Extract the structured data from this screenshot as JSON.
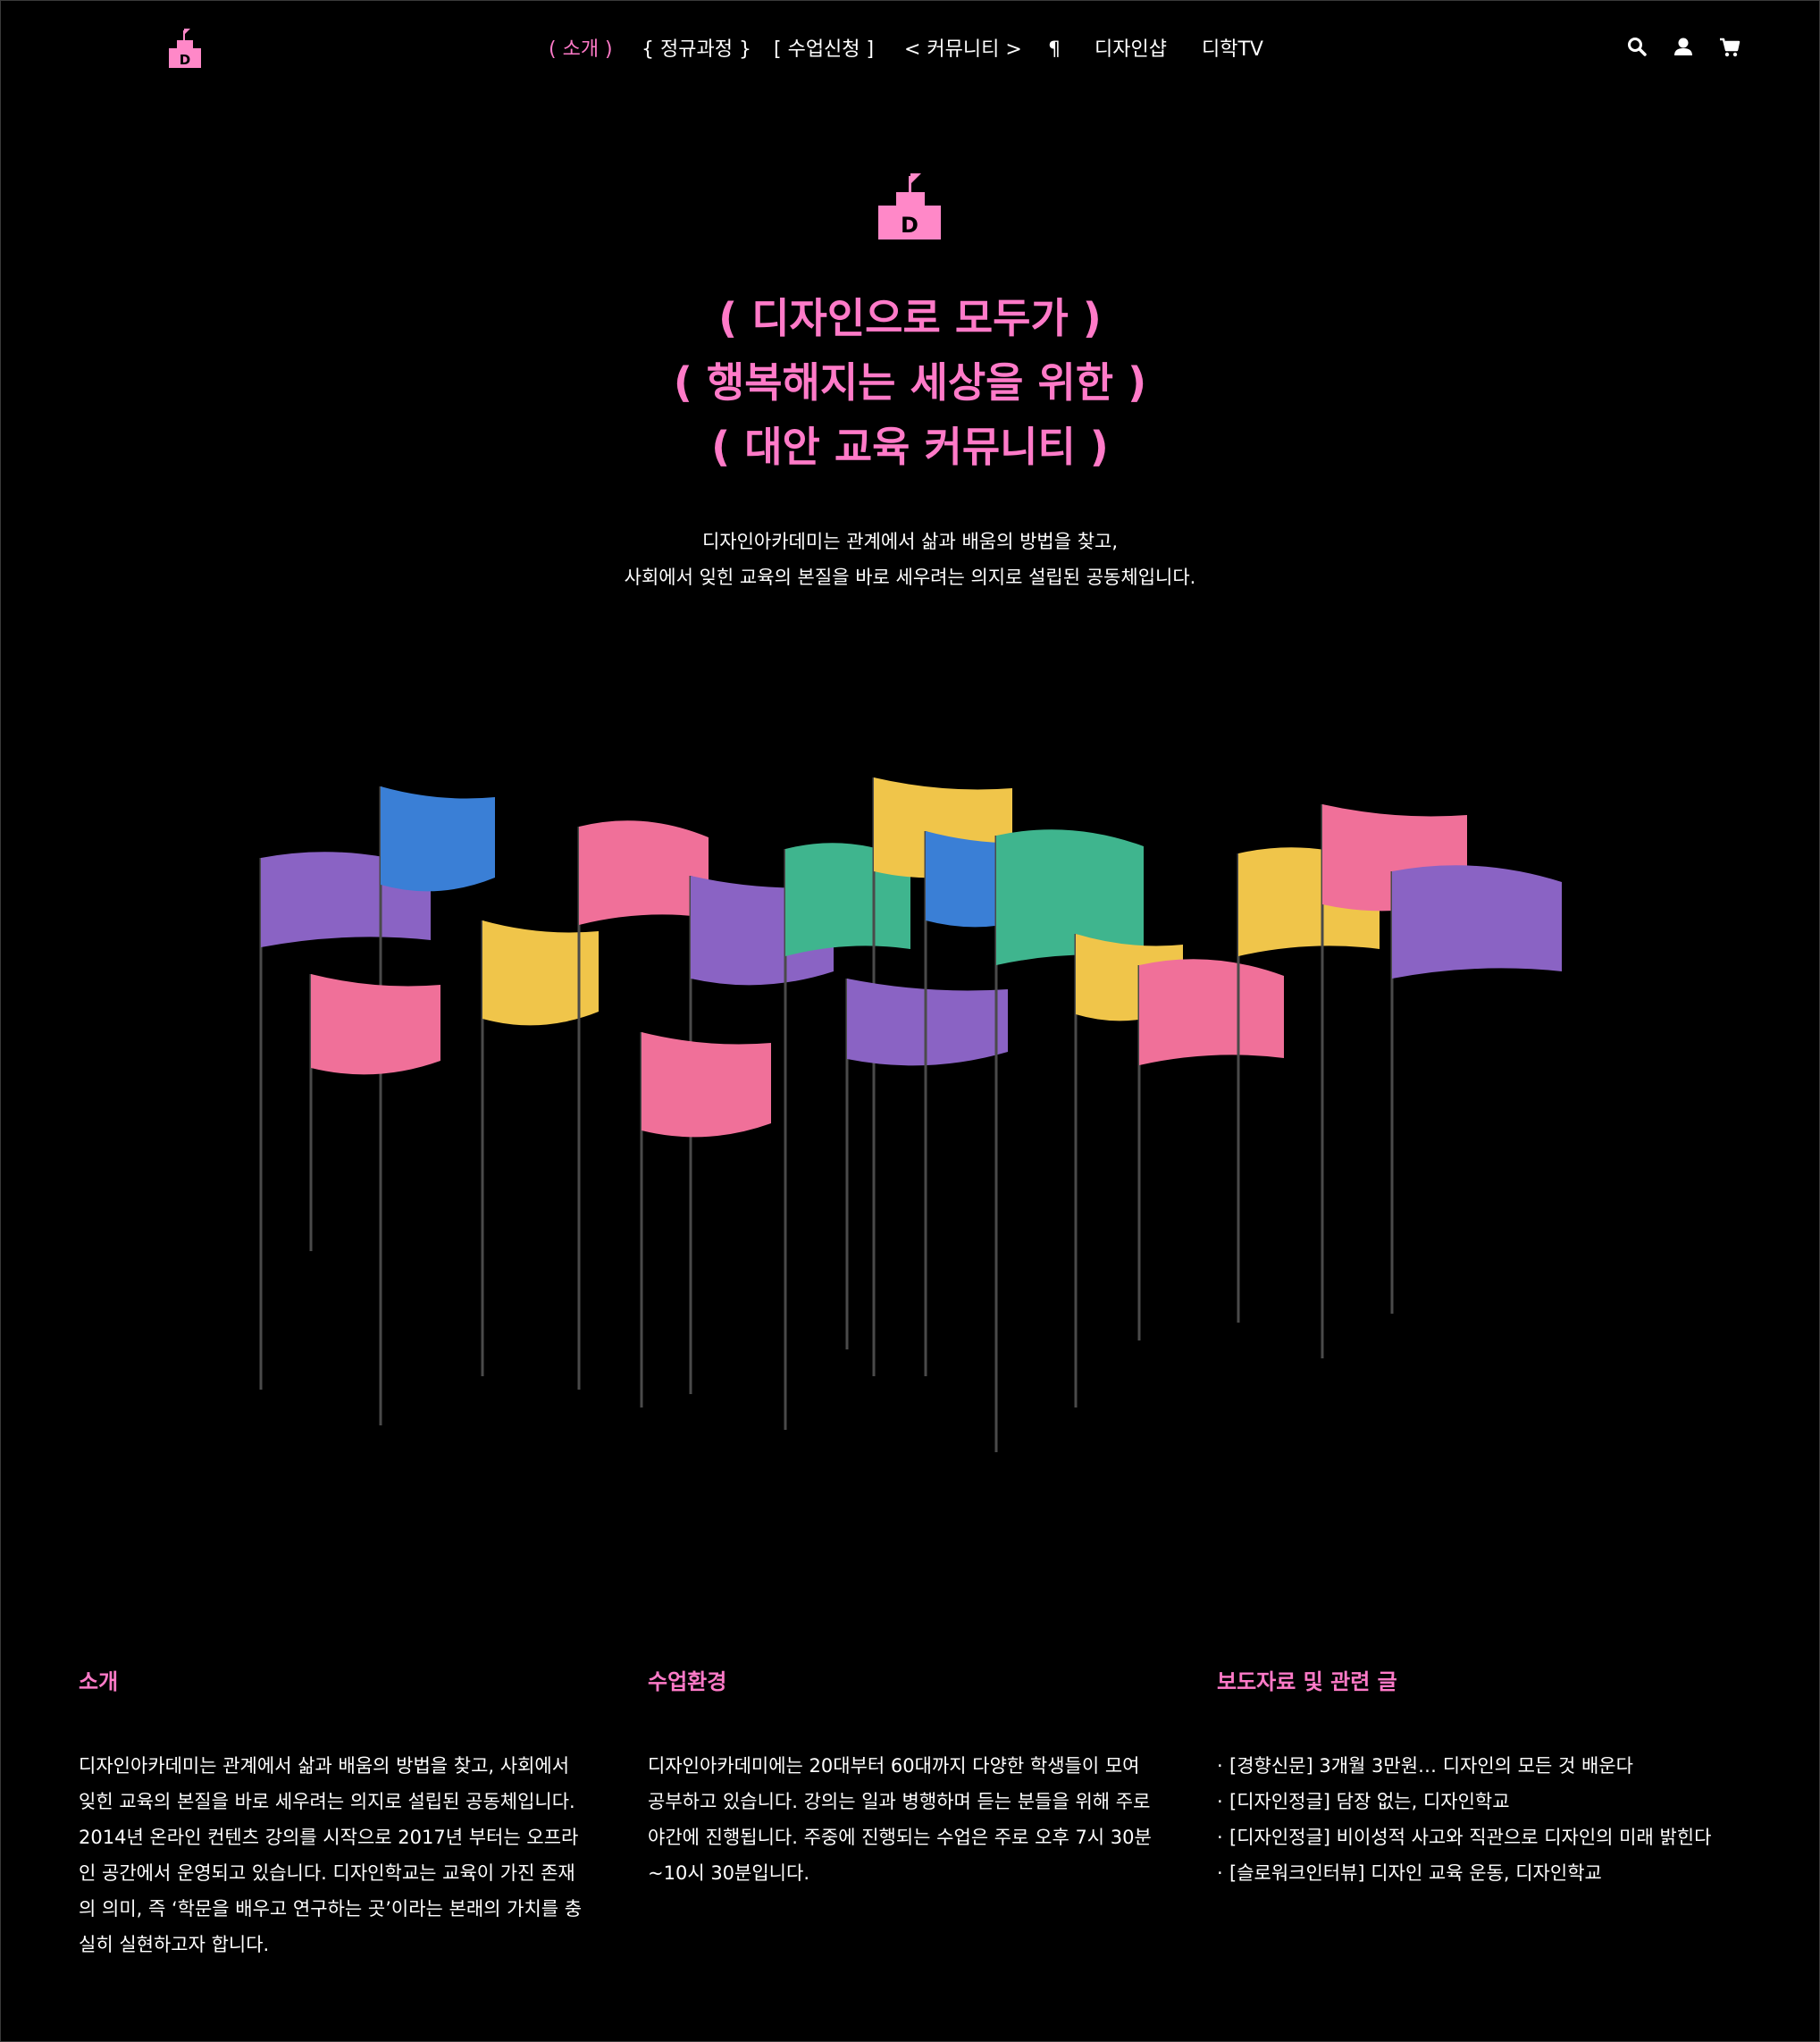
{
  "nav": {
    "items": [
      {
        "label": "( 소개 )",
        "active": true
      },
      {
        "label": "{ 정규과정 }",
        "active": false
      },
      {
        "label": "[ 수업신청 ]",
        "active": false
      },
      {
        "label": "< 커뮤니티 >",
        "active": false
      },
      {
        "label": "¶",
        "active": false
      },
      {
        "label": "디자인샵",
        "active": false
      },
      {
        "label": "디학TV",
        "active": false
      }
    ],
    "icons": [
      "search-icon",
      "user-icon",
      "cart-icon"
    ]
  },
  "logo": {
    "letter": "D",
    "color": "#ff88c8"
  },
  "hero": {
    "lines": [
      "( 디자인으로 모두가 )",
      "( 행복해지는 세상을 위한 )",
      "( 대안 교육 커뮤니티 )"
    ],
    "intro": [
      "디자인아카데미는 관계에서 삶과 배움의 방법을 찾고,",
      "사회에서 잊힌 교육의 본질을 바로 세우려는 의지로 설립된 공동체입니다."
    ]
  },
  "colors": {
    "accent": "#ff7ac8",
    "flag_purple": "#8a63c4",
    "flag_blue": "#3a7fd6",
    "flag_pink": "#f07099",
    "flag_yellow": "#f0c54a",
    "flag_green": "#3fb58e"
  },
  "sections": {
    "about": {
      "title": "소개",
      "lines": [
        "디자인아카데미는 관계에서 삶과 배움의 방법을 찾고, 사회에서",
        "잊힌 교육의 본질을 바로 세우려는 의지로 설립된 공동체입니다.",
        "2014년 온라인 컨텐츠 강의를 시작으로 2017년 부터는 오프라",
        "인 공간에서 운영되고 있습니다. 디자인학교는 교육이 가진 존재",
        "의 의미, 즉 ‘학문을 배우고 연구하는 곳’이라는 본래의 가치를 충",
        "실히 실현하고자 합니다."
      ]
    },
    "environment": {
      "title": "수업환경",
      "lines": [
        "디자인아카데미에는 20대부터 60대까지 다양한 학생들이 모여",
        "공부하고 있습니다. 강의는 일과 병행하며 듣는 분들을 위해 주로",
        "야간에 진행됩니다. 주중에 진행되는 수업은 주로 오후 7시 30분",
        "~10시 30분입니다."
      ]
    },
    "press": {
      "title": "보도자료 및 관련 글",
      "items": [
        "[경향신문] 3개월 3만원… 디자인의 모든 것 배운다",
        "[디자인정글] 담장 없는, 디자인학교",
        "[디자인정글] 비이성적 사고와 직관으로 디자인의 미래 밝힌다",
        "[슬로워크인터뷰] 디자인 교육 운동, 디자인학교"
      ]
    }
  }
}
